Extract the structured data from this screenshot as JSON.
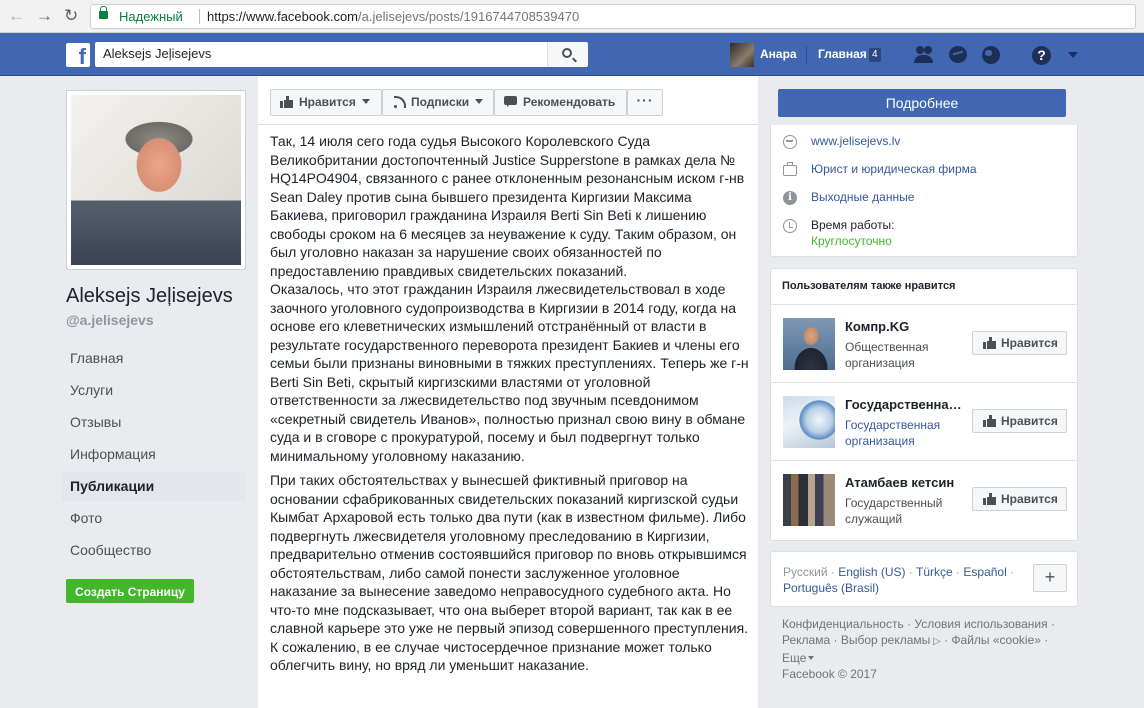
{
  "browser": {
    "secure_label": "Надежный",
    "url_host": "https://www.facebook.com",
    "url_path": "/a.jelisejevs/posts/1916744708539470"
  },
  "topbar": {
    "logo": "f",
    "search_value": "Aleksejs Jeļisejevs",
    "user_name": "Анара",
    "home_label": "Главная",
    "home_count": "4",
    "help": "?"
  },
  "profile": {
    "name": "Aleksejs Jeļisejevs",
    "handle": "@a.jelisejevs",
    "nav": [
      "Главная",
      "Услуги",
      "Отзывы",
      "Информация",
      "Публикации",
      "Фото",
      "Сообщество"
    ],
    "active_nav": "Публикации",
    "create_page": "Создать Страницу"
  },
  "actions": {
    "like": "Нравится",
    "follow": "Подписки",
    "recommend": "Рекомендовать",
    "more": "···",
    "learn_more": "Подробнее"
  },
  "post": {
    "paragraphs": [
      "Так, 14 июля сего года судья Высокого Королевского Суда Великобритании достопочтенный Justice Supperstone в рамках дела № HQ14PO4904, связанного с ранее отклоненным резонансным иском г-нв Sean Daley против сына бывшего президента Киргизии Максима Бакиева, приговорил гражданина Израиля Berti Sin Beti к лишению свободы сроком на 6 месяцев за неуважение к суду. Таким образом, он был уголовно наказан за нарушение своих обязанностей по предоставлению правдивых свидетельских показаний.\nОказалось, что этот гражданин Израиля лжесвидетельствовал в ходе заочного уголовного судопроизводства в Киргизии в 2014 году, когда на основе его клеветнических измышлений отстранённый от власти в результате государственного переворота президент Бакиев и члены его семьи были признаны виновными в тяжких преступлениях. Теперь же г-н Berti Sin Beti, скрытый киргизскими властями от уголовной ответственности за лжесвидетельство под звучным псевдонимом «секретный свидетель Иванов», полностью признал свою вину в обмане суда и в сговоре с прокуратурой, посему и был подвергнут только минимальному уголовному наказанию.",
      "При таких обстоятельствах у вынесшей фиктивный приговор на основании сфабрикованных свидетельских показаний киргизской судьи Кымбат Архаровой есть только два пути (как в известном фильме). Либо подвергнуть лжесвидетеля уголовному преследованию в Киргизии, предварительно отменив состоявшийся приговор по вновь открывшимся обстоятельствам, либо самой понести заслуженное уголовное наказание за вынесение заведомо неправосудного судебного акта. Но что-то мне подсказывает, что она выберет второй вариант, так как в ее славной карьере это уже не первый эпизод совершенного преступления. К сожалению, в ее случае чистосердечное признание может только облегчить вину, но вряд ли уменьшит наказание."
    ]
  },
  "info": {
    "website": "www.jelisejevs.lv",
    "category": "Юрист и юридическая фирма",
    "days_off": "Выходные данные",
    "hours_label": "Время работы:",
    "hours_value": "Круглосуточно"
  },
  "likes": {
    "heading": "Пользователям также нравится",
    "items": [
      {
        "name": "Компр.KG",
        "category": "Общественная организация",
        "button": "Нравится"
      },
      {
        "name": "Государственна…",
        "category": "Государственная организация",
        "button": "Нравится"
      },
      {
        "name": "Атамбаев кетсин",
        "category": "Государственный служащий",
        "button": "Нравится"
      }
    ]
  },
  "languages": {
    "current": "Русский",
    "others": [
      "English (US)",
      "Türkçe",
      "Español",
      "Português (Brasil)"
    ],
    "add": "+"
  },
  "footer": {
    "links": [
      "Конфиденциальность",
      "Условия использования",
      "Реклама",
      "Выбор рекламы",
      "Файлы «cookie»",
      "Еще"
    ],
    "copyright": "Facebook © 2017"
  },
  "colors": {
    "fb_blue": "#4267b2",
    "link": "#365899",
    "green": "#42b72a",
    "secure": "#0b8043"
  },
  "icons": [
    "back-icon",
    "forward-icon",
    "reload-icon",
    "lock-icon",
    "search-icon",
    "friends-icon",
    "messenger-icon",
    "notifications-icon",
    "help-icon",
    "globe-icon",
    "briefcase-icon",
    "info-icon",
    "clock-icon",
    "thumbs-up-icon",
    "rss-icon",
    "recommend-icon"
  ]
}
